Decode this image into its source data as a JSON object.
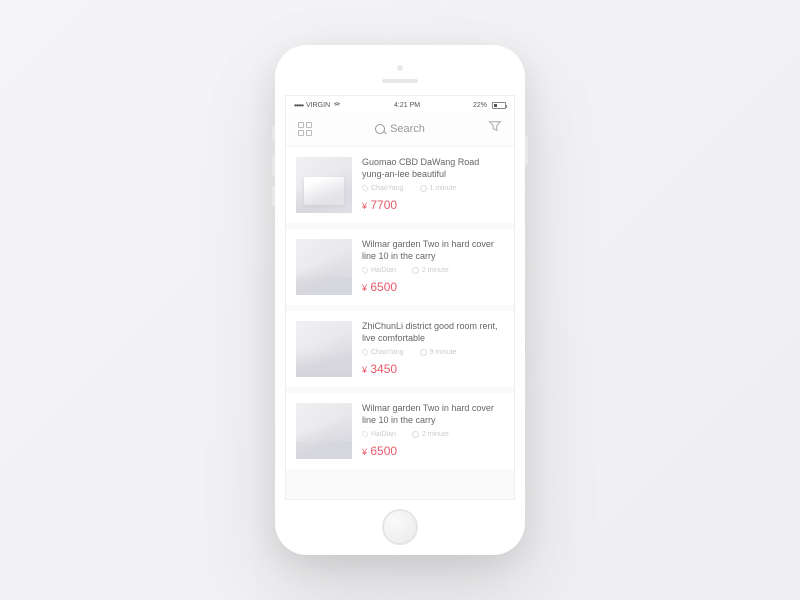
{
  "status_bar": {
    "carrier": "VIRGIN",
    "time": "4:21 PM",
    "battery_pct": "22%"
  },
  "nav": {
    "search_placeholder": "Search"
  },
  "currency_symbol": "¥",
  "listings": [
    {
      "title": "Guomao CBD DaWang Road yung-an-lee beautiful",
      "location": "ChaoYang",
      "time": "1 minute",
      "price": "7700"
    },
    {
      "title": "Wilmar garden Two in hard cover line 10 in the carry",
      "location": "HaiDian",
      "time": "2 minute",
      "price": "6500"
    },
    {
      "title": "ZhiChunLi district good room rent, live comfortable",
      "location": "ChaoYang",
      "time": "9 minute",
      "price": "3450"
    },
    {
      "title": "Wilmar garden Two in hard cover line 10 in the carry",
      "location": "HaiDian",
      "time": "2 minute",
      "price": "6500"
    }
  ]
}
